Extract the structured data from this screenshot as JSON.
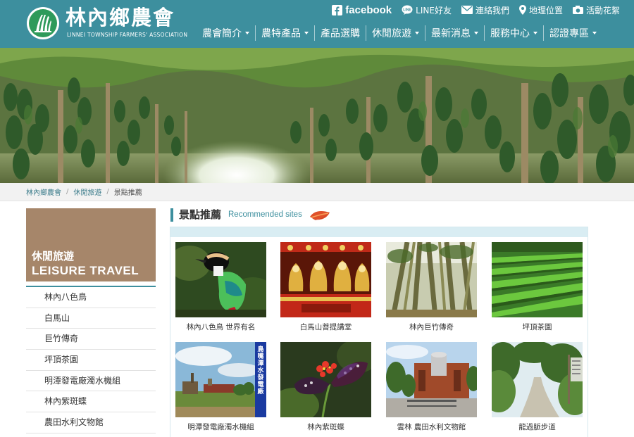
{
  "brand": {
    "name_zh": "林內鄉農會",
    "name_en": "LINNEI TOWNSHIP FARMERS' ASSOCIATION"
  },
  "top_links": [
    {
      "label": "facebook",
      "icon": "facebook-icon"
    },
    {
      "label": "LINE好友",
      "icon": "line-icon"
    },
    {
      "label": "連絡我們",
      "icon": "mail-icon"
    },
    {
      "label": "地理位置",
      "icon": "map-pin-icon"
    },
    {
      "label": "活動花絮",
      "icon": "camera-icon"
    }
  ],
  "nav": [
    {
      "label": "農會簡介",
      "dropdown": true
    },
    {
      "label": "農特產品",
      "dropdown": true
    },
    {
      "label": "產品選購",
      "dropdown": false
    },
    {
      "label": "休閒旅遊",
      "dropdown": true
    },
    {
      "label": "最新消息",
      "dropdown": true
    },
    {
      "label": "服務中心",
      "dropdown": true
    },
    {
      "label": "認證專區",
      "dropdown": true
    }
  ],
  "breadcrumb": [
    "林內鄉農會",
    "休閒旅遊",
    "景點推薦"
  ],
  "sidebar": {
    "title_zh": "休閒旅遊",
    "title_en": "LEISURE TRAVEL",
    "items": [
      "林內八色鳥",
      "白馬山",
      "巨竹傳奇",
      "坪頂茶園",
      "明潭發電廠濁水機組",
      "林內紫斑蝶",
      "農田水利文物館"
    ]
  },
  "section": {
    "title": "景點推薦",
    "subtitle": "Recommended sites"
  },
  "spots": [
    {
      "caption": "林內八色鳥 世界有名"
    },
    {
      "caption": "白馬山菩提講堂"
    },
    {
      "caption": "林內巨竹傳奇"
    },
    {
      "caption": "坪頂茶園"
    },
    {
      "caption": "明潭發電廠濁水機組",
      "sign_text": "鳥嘴潭水發電廠"
    },
    {
      "caption": "林內紫斑蝶"
    },
    {
      "caption": "雲林 農田水利文物館"
    },
    {
      "caption": "龍過脈步道"
    }
  ],
  "colors": {
    "header": "#3d8f9e",
    "sidebar_hero": "#a6866a",
    "panel_top": "#d9edf3",
    "accent_leaf": "#e0502a"
  }
}
